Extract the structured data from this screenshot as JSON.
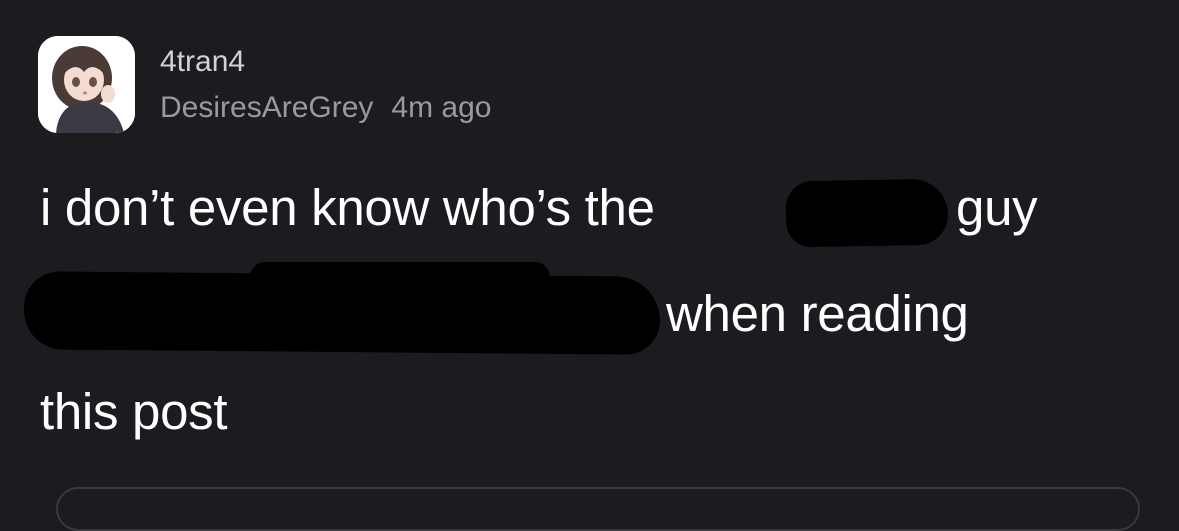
{
  "post": {
    "author": "4tran4",
    "community": "DesiresAreGrey",
    "timestamp": "4m ago",
    "avatar_icon": "anime-girl-avatar-icon",
    "body": {
      "line1_before_redaction": "i don’t even know who’s the",
      "line1_after_redaction": "guy",
      "line2_after_redaction": "when reading",
      "line3": "this post"
    }
  },
  "colors": {
    "background": "#1c1b20",
    "text_primary": "#ffffff",
    "text_secondary": "#9a99a0",
    "redaction": "#000000"
  }
}
